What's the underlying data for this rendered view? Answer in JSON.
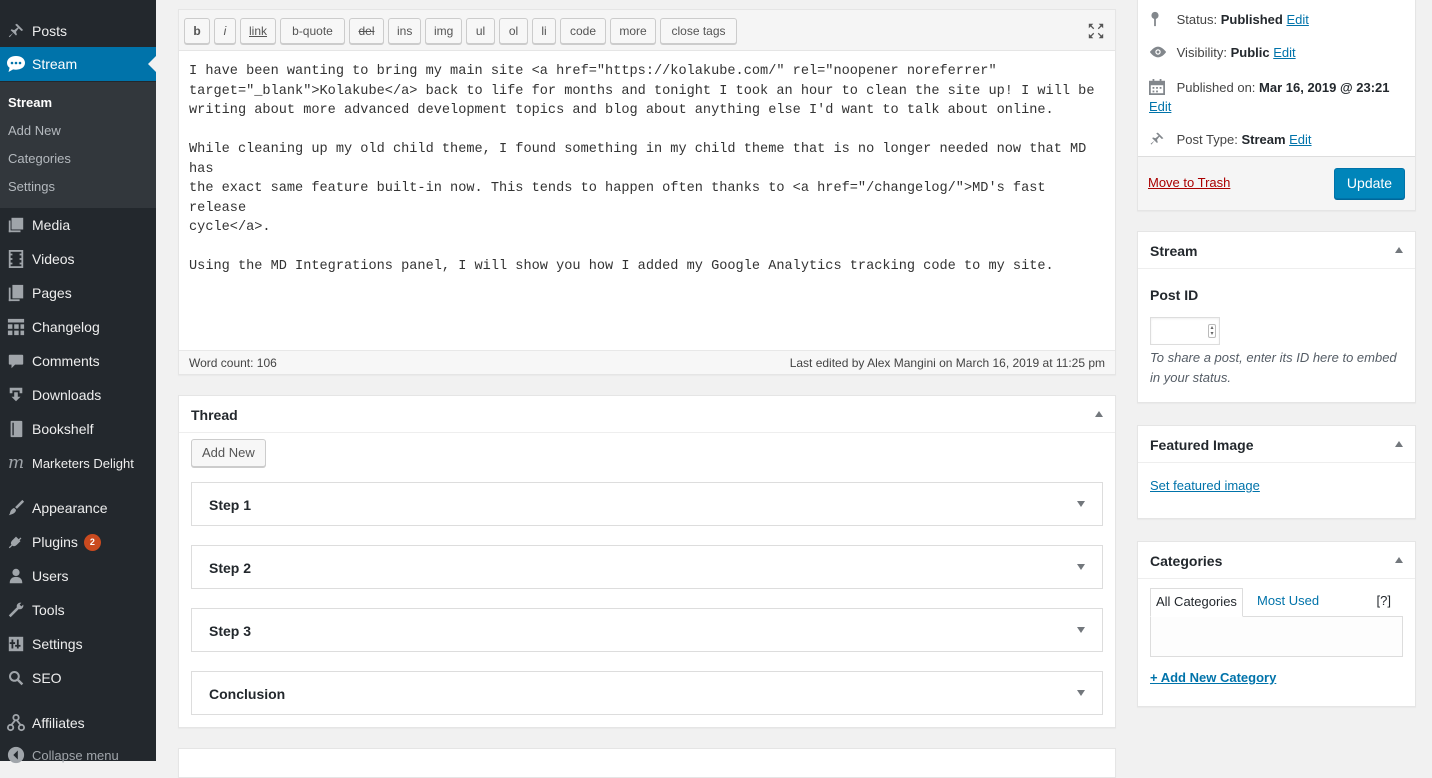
{
  "sidebar": {
    "items": [
      {
        "label": "Posts",
        "icon": "pin-icon"
      },
      {
        "label": "Stream",
        "icon": "speech-bubble-icon"
      },
      {
        "label": "Media",
        "icon": "media-icon"
      },
      {
        "label": "Videos",
        "icon": "film-icon"
      },
      {
        "label": "Pages",
        "icon": "pages-icon"
      },
      {
        "label": "Changelog",
        "icon": "grid-icon"
      },
      {
        "label": "Comments",
        "icon": "comment-icon"
      },
      {
        "label": "Downloads",
        "icon": "download-icon"
      },
      {
        "label": "Bookshelf",
        "icon": "book-icon"
      },
      {
        "label": "Marketers Delight",
        "icon": "md-logo-icon"
      },
      {
        "label": "Appearance",
        "icon": "brush-icon"
      },
      {
        "label": "Plugins",
        "icon": "plug-icon",
        "badge": "2"
      },
      {
        "label": "Users",
        "icon": "user-icon"
      },
      {
        "label": "Tools",
        "icon": "wrench-icon"
      },
      {
        "label": "Settings",
        "icon": "settings-icon"
      },
      {
        "label": "SEO",
        "icon": "search-icon"
      },
      {
        "label": "Affiliates",
        "icon": "network-icon"
      },
      {
        "label": "Collapse menu",
        "icon": "collapse-icon"
      }
    ],
    "submenu": [
      "Stream",
      "Add New",
      "Categories",
      "Settings"
    ]
  },
  "editor": {
    "toolbar": [
      "b",
      "i",
      "link",
      "b-quote",
      "del",
      "ins",
      "img",
      "ul",
      "ol",
      "li",
      "code",
      "more",
      "close tags"
    ],
    "paragraphs": [
      "I have been wanting to bring my main site <a href=\"https://kolakube.com/\" rel=\"noopener noreferrer\"\ntarget=\"_blank\">Kolakube</a> back to life for months and tonight I took an hour to clean the site up! I will be\nwriting about more advanced development topics and blog about anything else I'd want to talk about online.",
      "While cleaning up my old child theme, I found something in my child theme that is no longer needed now that MD has\nthe exact same feature built-in now. This tends to happen often thanks to <a href=\"/changelog/\">MD's fast release\ncycle</a>.",
      "Using the MD Integrations panel, I will show you how I added my Google Analytics tracking code to my site."
    ],
    "word_count": "Word count: 106",
    "last_edited": "Last edited by Alex Mangini on March 16, 2019 at 11:25 pm"
  },
  "thread": {
    "title": "Thread",
    "add_new": "Add New",
    "steps": [
      "Step 1",
      "Step 2",
      "Step 3",
      "Conclusion"
    ]
  },
  "publish": {
    "status_label": "Status:",
    "status_value": "Published",
    "visibility_label": "Visibility:",
    "visibility_value": "Public",
    "published_label": "Published on:",
    "published_value": "Mar 16, 2019 @ 23:21",
    "post_type_label": "Post Type:",
    "post_type_value": "Stream",
    "edit": "Edit",
    "move_to_trash": "Move to Trash",
    "update": "Update"
  },
  "stream_box": {
    "title": "Stream",
    "post_id_label": "Post ID",
    "post_id_value": "",
    "help": "To share a post, enter its ID here to embed in your status."
  },
  "featured_box": {
    "title": "Featured Image",
    "link": "Set featured image"
  },
  "categories_box": {
    "title": "Categories",
    "tab_all": "All Categories",
    "tab_most": "Most Used",
    "help": "[?]",
    "add_new": "+ Add New Category"
  },
  "colors": {
    "sidebar_bg": "#23282d",
    "accent": "#0073aa",
    "primary_button": "#0085ba",
    "badge": "#ca4a1f",
    "trash": "#a00"
  }
}
